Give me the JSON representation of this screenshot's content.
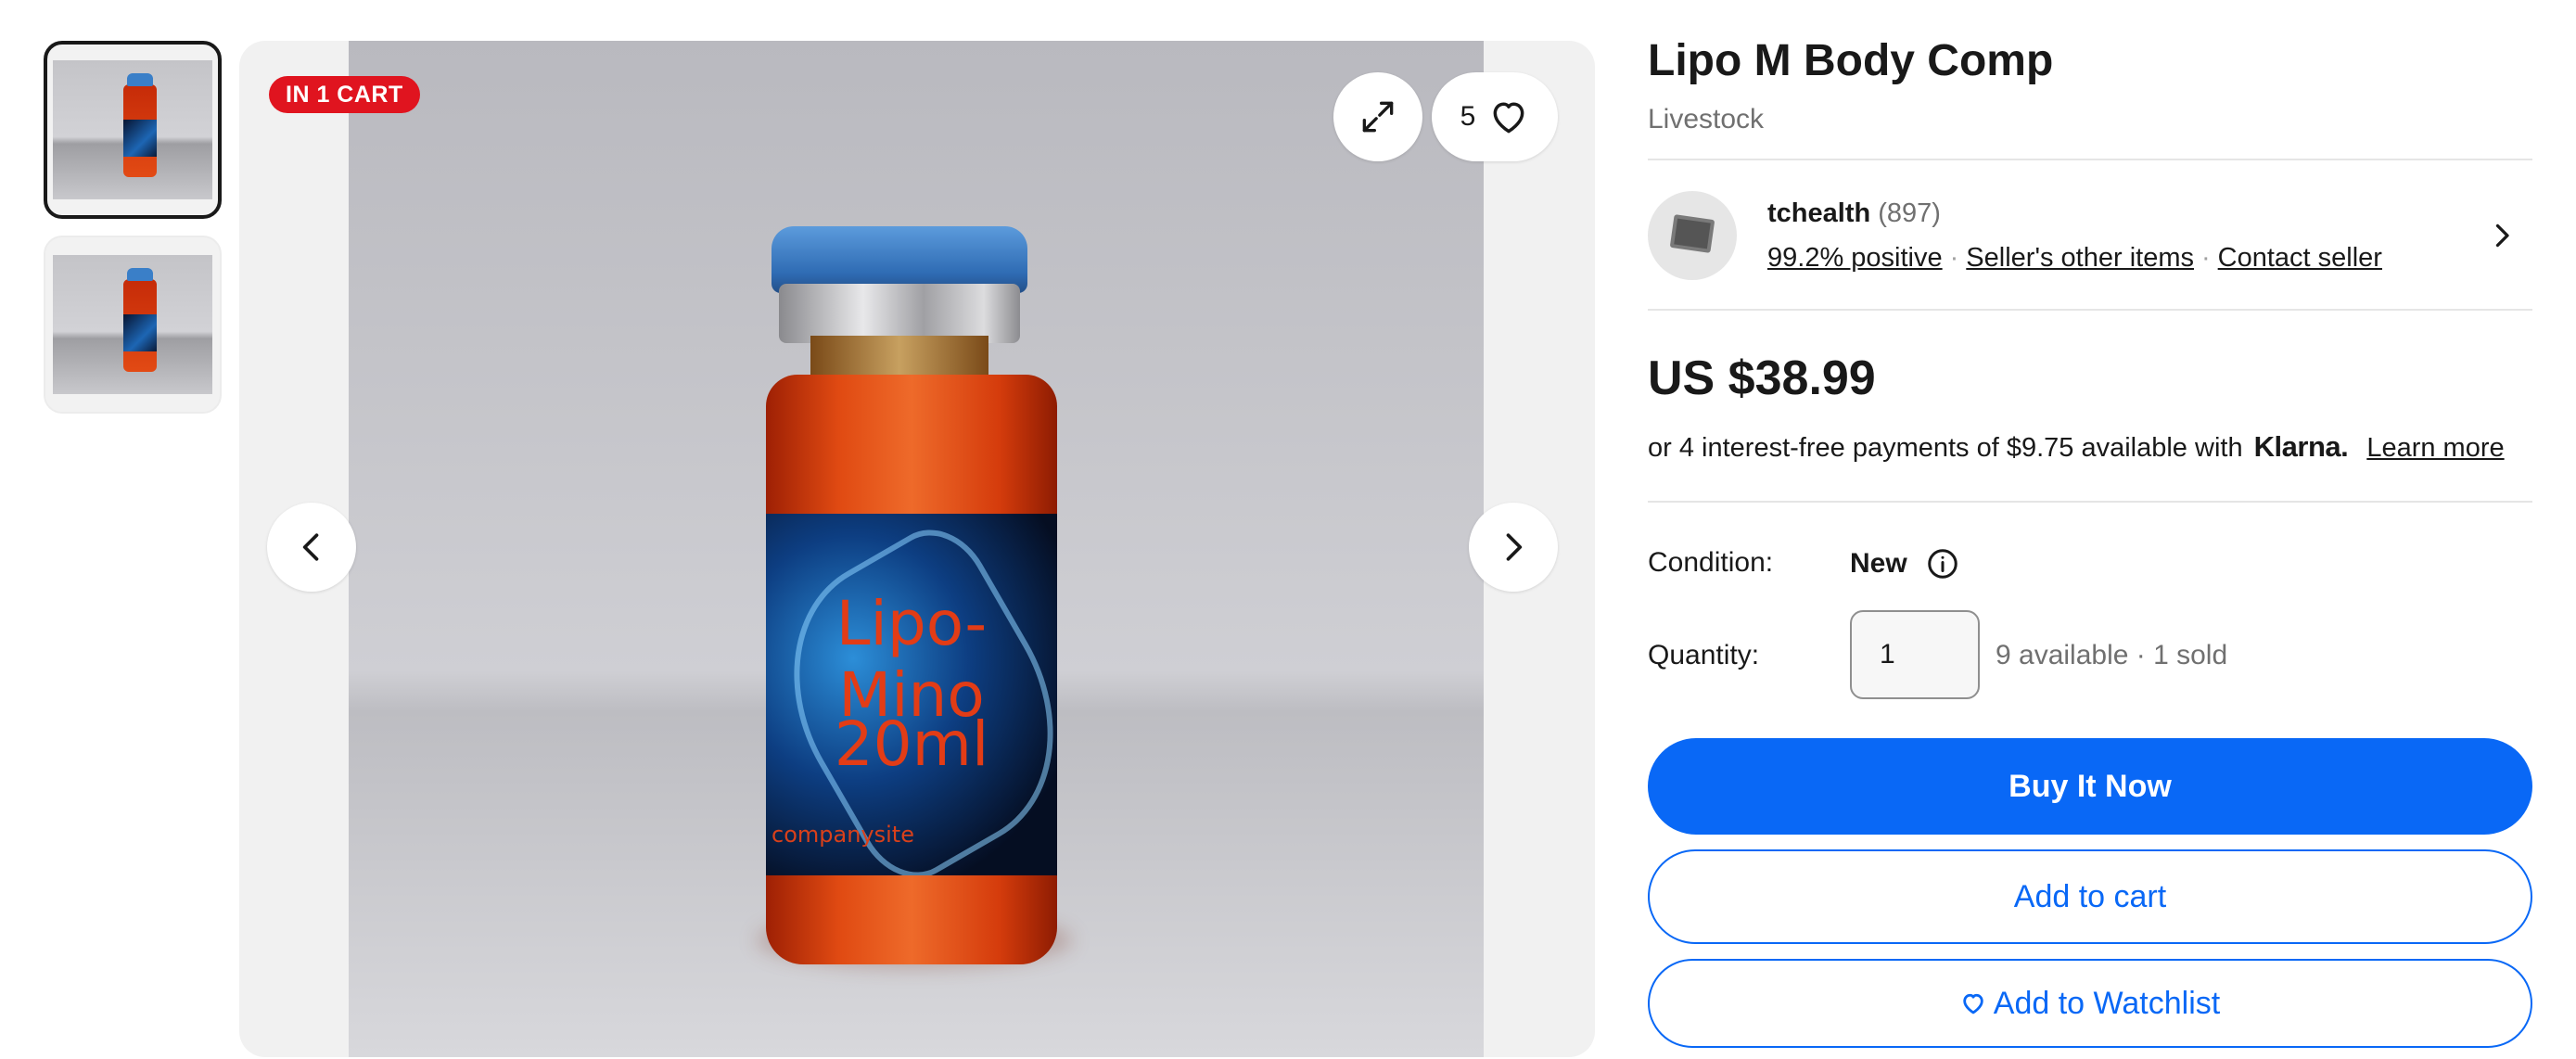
{
  "gallery": {
    "badge": "IN 1 CART",
    "watch_count": "5",
    "thumbnails": [
      "thumbnail-1",
      "thumbnail-2"
    ],
    "label_text": [
      "Lipo-Mino",
      "20ml",
      "companysite"
    ]
  },
  "product": {
    "title": "Lipo M Body Comp",
    "category": "Livestock"
  },
  "seller": {
    "name": "tchealth",
    "feedback_count": "(897)",
    "positive": "99.2% positive",
    "other_items": "Seller's other items",
    "contact": "Contact seller"
  },
  "pricing": {
    "price": "US $38.99",
    "klarna_text": "or 4 interest-free payments of $9.75 available with",
    "klarna_brand": "Klarna.",
    "learn_more": "Learn more"
  },
  "details": {
    "condition_label": "Condition:",
    "condition_value": "New",
    "quantity_label": "Quantity:",
    "quantity_value": "1",
    "quantity_info": "9 available · 1 sold"
  },
  "actions": {
    "buy_now": "Buy It Now",
    "add_to_cart": "Add to cart",
    "add_to_watchlist": "Add to Watchlist"
  },
  "colors": {
    "accent": "#0968f6",
    "badge": "#e0141f"
  }
}
